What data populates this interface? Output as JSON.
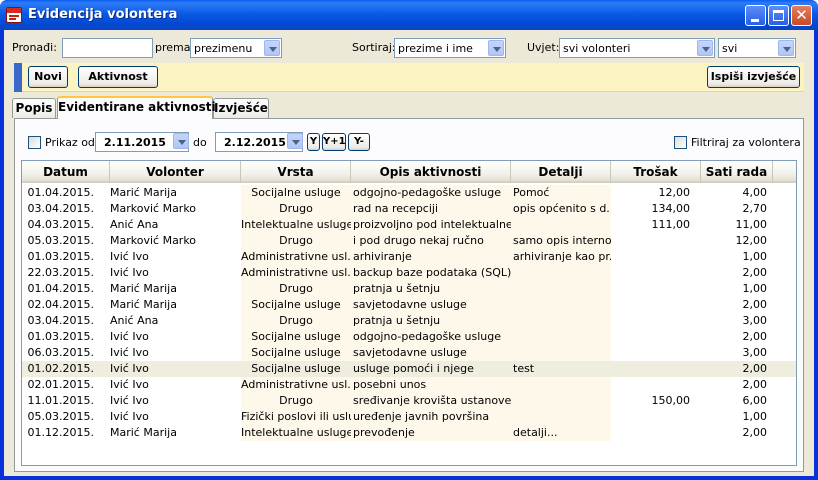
{
  "window": {
    "title": "Evidencija volontera"
  },
  "filters": {
    "find_label": "Pronađi:",
    "find_value": "",
    "by_label": "prema",
    "by_value": "prezimenu",
    "sort_label": "Sortiraj:",
    "sort_value": "prezime i ime",
    "cond_label": "Uvjet:",
    "cond_value": "svi volonteri",
    "cond2_value": "svi"
  },
  "toolbar": {
    "new_label": "Novi",
    "activity_label": "Aktivnost",
    "print_label": "Ispiši izvješće"
  },
  "tabs": [
    {
      "label": "Popis"
    },
    {
      "label": "Evidentirane aktivnosti"
    },
    {
      "label": "Izvješće"
    }
  ],
  "period": {
    "show_from_label": "Prikaz od",
    "from": "2.11.2015",
    "to_label": "do",
    "to": "2.12.2015",
    "btn_y": "Y",
    "btn_y_plus": "Y+1",
    "btn_y_minus": "Y-",
    "filter_label": "Filtriraj za volontera"
  },
  "grid": {
    "columns": [
      "Datum",
      "Volonter",
      "Vrsta",
      "Opis aktivnosti",
      "Detalji",
      "Trošak",
      "Sati rada"
    ],
    "rows": [
      {
        "datum": "01.04.2015.",
        "volonter": "Marić Marija",
        "vrsta": "Socijalne usluge",
        "opis": "odgojno-pedagoške usluge",
        "detalji": "Pomoć",
        "trosak": "12,00",
        "sati": "4,00"
      },
      {
        "datum": "03.04.2015.",
        "volonter": "Marković Marko",
        "vrsta": "Drugo",
        "opis": "rad na recepciji",
        "detalji": "opis općenito s d...",
        "trosak": "134,00",
        "sati": "2,70"
      },
      {
        "datum": "04.03.2015.",
        "volonter": "Anić Ana",
        "vrsta": "Intelektualne usluge",
        "opis": "proizvoljno pod intelektualne",
        "detalji": "",
        "trosak": "111,00",
        "sati": "11,00"
      },
      {
        "datum": "05.03.2015.",
        "volonter": "Marković Marko",
        "vrsta": "Drugo",
        "opis": "i pod drugo nekaj ručno",
        "detalji": "samo opis interno",
        "trosak": "",
        "sati": "12,00"
      },
      {
        "datum": "01.03.2015.",
        "volonter": "Ivić Ivo",
        "vrsta": "Administrativne usl...",
        "opis": "arhiviranje",
        "detalji": "arhiviranje kao pr...",
        "trosak": "",
        "sati": "1,00"
      },
      {
        "datum": "22.03.2015.",
        "volonter": "Ivić Ivo",
        "vrsta": "Administrativne usl...",
        "opis": "backup baze podataka (SQL)",
        "detalji": "",
        "trosak": "",
        "sati": "2,00"
      },
      {
        "datum": "01.04.2015.",
        "volonter": "Marić Marija",
        "vrsta": "Drugo",
        "opis": "pratnja u šetnju",
        "detalji": "",
        "trosak": "",
        "sati": "1,00"
      },
      {
        "datum": "02.04.2015.",
        "volonter": "Marić Marija",
        "vrsta": "Socijalne usluge",
        "opis": "savjetodavne usluge",
        "detalji": "",
        "trosak": "",
        "sati": "2,00"
      },
      {
        "datum": "03.04.2015.",
        "volonter": "Anić Ana",
        "vrsta": "Drugo",
        "opis": "pratnja u šetnju",
        "detalji": "",
        "trosak": "",
        "sati": "3,00"
      },
      {
        "datum": "01.03.2015.",
        "volonter": "Ivić Ivo",
        "vrsta": "Socijalne usluge",
        "opis": "odgojno-pedagoške usluge",
        "detalji": "",
        "trosak": "",
        "sati": "2,00"
      },
      {
        "datum": "06.03.2015.",
        "volonter": "Ivić Ivo",
        "vrsta": "Socijalne usluge",
        "opis": "savjetodavne usluge",
        "detalji": "",
        "trosak": "",
        "sati": "3,00"
      },
      {
        "datum": "01.02.2015.",
        "volonter": "Ivić Ivo",
        "vrsta": "Socijalne usluge",
        "opis": "usluge pomoći i njege",
        "detalji": "test",
        "trosak": "",
        "sati": "2,00",
        "selected": true
      },
      {
        "datum": "02.01.2015.",
        "volonter": "Ivić Ivo",
        "vrsta": "Administrativne usl...",
        "opis": "posebni unos",
        "detalji": "",
        "trosak": "",
        "sati": "2,00"
      },
      {
        "datum": "11.01.2015.",
        "volonter": "Ivić Ivo",
        "vrsta": "Drugo",
        "opis": "sređivanje krovišta ustanove",
        "detalji": "",
        "trosak": "150,00",
        "sati": "6,00"
      },
      {
        "datum": "05.03.2015.",
        "volonter": "Ivić Ivo",
        "vrsta": "Fizički poslovi ili usluge",
        "opis": "uređenje javnih površina",
        "detalji": "",
        "trosak": "",
        "sati": "1,00"
      },
      {
        "datum": "01.12.2015.",
        "volonter": "Marić Marija",
        "vrsta": "Intelektualne usluge",
        "opis": "prevođenje",
        "detalji": "detalji...",
        "trosak": "",
        "sati": "2,00"
      }
    ]
  }
}
